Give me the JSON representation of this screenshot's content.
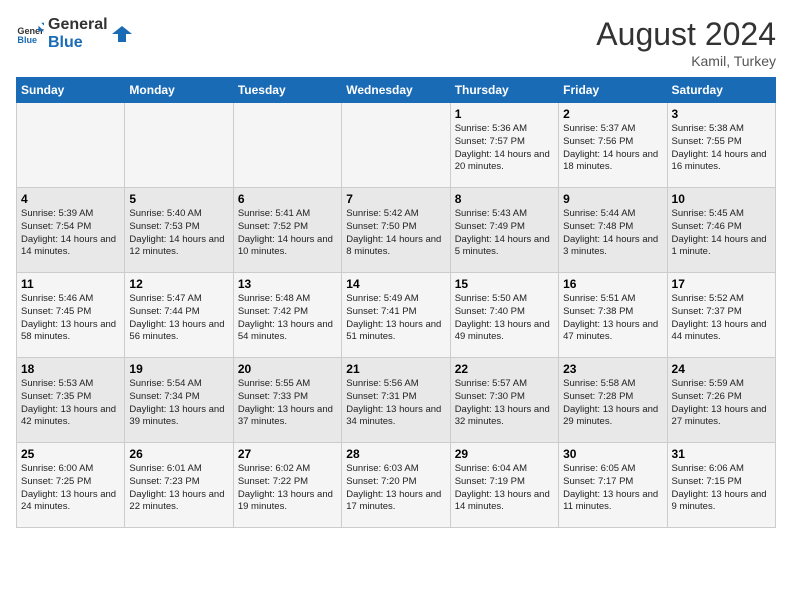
{
  "logo": {
    "general": "General",
    "blue": "Blue"
  },
  "header": {
    "month_year": "August 2024",
    "location": "Kamil, Turkey"
  },
  "weekdays": [
    "Sunday",
    "Monday",
    "Tuesday",
    "Wednesday",
    "Thursday",
    "Friday",
    "Saturday"
  ],
  "weeks": [
    [
      {
        "day": "",
        "info": ""
      },
      {
        "day": "",
        "info": ""
      },
      {
        "day": "",
        "info": ""
      },
      {
        "day": "",
        "info": ""
      },
      {
        "day": "1",
        "info": "Sunrise: 5:36 AM\nSunset: 7:57 PM\nDaylight: 14 hours\nand 20 minutes."
      },
      {
        "day": "2",
        "info": "Sunrise: 5:37 AM\nSunset: 7:56 PM\nDaylight: 14 hours\nand 18 minutes."
      },
      {
        "day": "3",
        "info": "Sunrise: 5:38 AM\nSunset: 7:55 PM\nDaylight: 14 hours\nand 16 minutes."
      }
    ],
    [
      {
        "day": "4",
        "info": "Sunrise: 5:39 AM\nSunset: 7:54 PM\nDaylight: 14 hours\nand 14 minutes."
      },
      {
        "day": "5",
        "info": "Sunrise: 5:40 AM\nSunset: 7:53 PM\nDaylight: 14 hours\nand 12 minutes."
      },
      {
        "day": "6",
        "info": "Sunrise: 5:41 AM\nSunset: 7:52 PM\nDaylight: 14 hours\nand 10 minutes."
      },
      {
        "day": "7",
        "info": "Sunrise: 5:42 AM\nSunset: 7:50 PM\nDaylight: 14 hours\nand 8 minutes."
      },
      {
        "day": "8",
        "info": "Sunrise: 5:43 AM\nSunset: 7:49 PM\nDaylight: 14 hours\nand 5 minutes."
      },
      {
        "day": "9",
        "info": "Sunrise: 5:44 AM\nSunset: 7:48 PM\nDaylight: 14 hours\nand 3 minutes."
      },
      {
        "day": "10",
        "info": "Sunrise: 5:45 AM\nSunset: 7:46 PM\nDaylight: 14 hours\nand 1 minute."
      }
    ],
    [
      {
        "day": "11",
        "info": "Sunrise: 5:46 AM\nSunset: 7:45 PM\nDaylight: 13 hours\nand 58 minutes."
      },
      {
        "day": "12",
        "info": "Sunrise: 5:47 AM\nSunset: 7:44 PM\nDaylight: 13 hours\nand 56 minutes."
      },
      {
        "day": "13",
        "info": "Sunrise: 5:48 AM\nSunset: 7:42 PM\nDaylight: 13 hours\nand 54 minutes."
      },
      {
        "day": "14",
        "info": "Sunrise: 5:49 AM\nSunset: 7:41 PM\nDaylight: 13 hours\nand 51 minutes."
      },
      {
        "day": "15",
        "info": "Sunrise: 5:50 AM\nSunset: 7:40 PM\nDaylight: 13 hours\nand 49 minutes."
      },
      {
        "day": "16",
        "info": "Sunrise: 5:51 AM\nSunset: 7:38 PM\nDaylight: 13 hours\nand 47 minutes."
      },
      {
        "day": "17",
        "info": "Sunrise: 5:52 AM\nSunset: 7:37 PM\nDaylight: 13 hours\nand 44 minutes."
      }
    ],
    [
      {
        "day": "18",
        "info": "Sunrise: 5:53 AM\nSunset: 7:35 PM\nDaylight: 13 hours\nand 42 minutes."
      },
      {
        "day": "19",
        "info": "Sunrise: 5:54 AM\nSunset: 7:34 PM\nDaylight: 13 hours\nand 39 minutes."
      },
      {
        "day": "20",
        "info": "Sunrise: 5:55 AM\nSunset: 7:33 PM\nDaylight: 13 hours\nand 37 minutes."
      },
      {
        "day": "21",
        "info": "Sunrise: 5:56 AM\nSunset: 7:31 PM\nDaylight: 13 hours\nand 34 minutes."
      },
      {
        "day": "22",
        "info": "Sunrise: 5:57 AM\nSunset: 7:30 PM\nDaylight: 13 hours\nand 32 minutes."
      },
      {
        "day": "23",
        "info": "Sunrise: 5:58 AM\nSunset: 7:28 PM\nDaylight: 13 hours\nand 29 minutes."
      },
      {
        "day": "24",
        "info": "Sunrise: 5:59 AM\nSunset: 7:26 PM\nDaylight: 13 hours\nand 27 minutes."
      }
    ],
    [
      {
        "day": "25",
        "info": "Sunrise: 6:00 AM\nSunset: 7:25 PM\nDaylight: 13 hours\nand 24 minutes."
      },
      {
        "day": "26",
        "info": "Sunrise: 6:01 AM\nSunset: 7:23 PM\nDaylight: 13 hours\nand 22 minutes."
      },
      {
        "day": "27",
        "info": "Sunrise: 6:02 AM\nSunset: 7:22 PM\nDaylight: 13 hours\nand 19 minutes."
      },
      {
        "day": "28",
        "info": "Sunrise: 6:03 AM\nSunset: 7:20 PM\nDaylight: 13 hours\nand 17 minutes."
      },
      {
        "day": "29",
        "info": "Sunrise: 6:04 AM\nSunset: 7:19 PM\nDaylight: 13 hours\nand 14 minutes."
      },
      {
        "day": "30",
        "info": "Sunrise: 6:05 AM\nSunset: 7:17 PM\nDaylight: 13 hours\nand 11 minutes."
      },
      {
        "day": "31",
        "info": "Sunrise: 6:06 AM\nSunset: 7:15 PM\nDaylight: 13 hours\nand 9 minutes."
      }
    ]
  ]
}
